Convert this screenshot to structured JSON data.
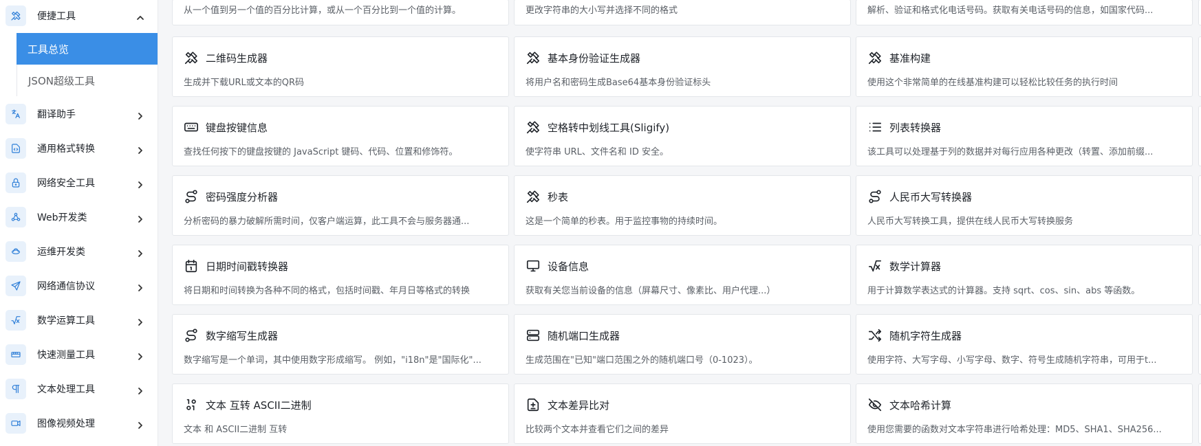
{
  "sidebar": {
    "groups": [
      {
        "label": "便捷工具",
        "icon": "tools-icon",
        "expanded": true
      },
      {
        "label": "翻译助手",
        "icon": "translate-icon"
      },
      {
        "label": "通用格式转换",
        "icon": "file-convert-icon"
      },
      {
        "label": "网络安全工具",
        "icon": "lock-icon"
      },
      {
        "label": "Web开发类",
        "icon": "webhook-icon"
      },
      {
        "label": "运维开发类",
        "icon": "devops-icon"
      },
      {
        "label": "网络通信协议",
        "icon": "send-icon"
      },
      {
        "label": "数学运算工具",
        "icon": "sqrt-icon"
      },
      {
        "label": "快速测量工具",
        "icon": "ruler-icon"
      },
      {
        "label": "文本处理工具",
        "icon": "pilcrow-icon"
      },
      {
        "label": "图像视频处理",
        "icon": "video-icon"
      }
    ],
    "sub_items": [
      {
        "label": "工具总览",
        "active": true
      },
      {
        "label": "JSON超级工具",
        "active": false
      }
    ]
  },
  "top_cards": [
    {
      "desc": "从一个值到另一个值的百分比计算，或从一个百分比到一个值的计算。"
    },
    {
      "desc": "更改字符串的大小写并选择不同的格式"
    },
    {
      "desc": "解析、验证和格式化电话号码。获取有关电话号码的信息，如国家代码..."
    }
  ],
  "cards": [
    {
      "title": "二维码生成器",
      "desc": "生成并下载URL或文本的QR码",
      "icon": "tools-icon"
    },
    {
      "title": "基本身份验证生成器",
      "desc": "将用户名和密码生成Base64基本身份验证标头",
      "icon": "tools-icon"
    },
    {
      "title": "基准构建",
      "desc": "使用这个非常简单的在线基准构建可以轻松比较任务的执行时间",
      "icon": "tools-icon"
    },
    {
      "title": "键盘按键信息",
      "desc": "查找任何按下的键盘按键的 JavaScript 键码、代码、位置和修饰符。",
      "icon": "keyboard-icon"
    },
    {
      "title": "空格转中划线工具(Sligify)",
      "desc": "使字符串 URL、文件名和 ID 安全。",
      "icon": "tools-icon"
    },
    {
      "title": "列表转换器",
      "desc": "该工具可以处理基于列的数据并对每行应用各种更改（转置、添加前缀...",
      "icon": "list-icon"
    },
    {
      "title": "密码强度分析器",
      "desc": "分析密码的暴力破解所需时间，仅客户端运算，此工具不会与服务器通...",
      "icon": "route-icon"
    },
    {
      "title": "秒表",
      "desc": "这是一个简单的秒表。用于监控事物的持续时间。",
      "icon": "tools-icon"
    },
    {
      "title": "人民币大写转换器",
      "desc": "人民币大写转换工具，提供在线人民币大写转换服务",
      "icon": "route-icon"
    },
    {
      "title": "日期时间戳转换器",
      "desc": "将日期和时间转换为各种不同的格式，包括时间戳、年月日等格式的转换",
      "icon": "calendar-icon"
    },
    {
      "title": "设备信息",
      "desc": "获取有关您当前设备的信息（屏幕尺寸、像素比、用户代理...）",
      "icon": "monitor-icon"
    },
    {
      "title": "数学计算器",
      "desc": "用于计算数学表达式的计算器。支持 sqrt、cos、sin、abs 等函数。",
      "icon": "sqrt-icon"
    },
    {
      "title": "数字缩写生成器",
      "desc": "数字缩写是一个单词，其中使用数字形成缩写。 例如，\"i18n\"是\"国际化\"...",
      "icon": "route-icon"
    },
    {
      "title": "随机端口生成器",
      "desc": "生成范围在\"已知\"端口范围之外的随机端口号（0-1023）。",
      "icon": "server-icon"
    },
    {
      "title": "随机字符生成器",
      "desc": "使用字符、大写字母、小写字母、数字、符号生成随机字符串，可用于t...",
      "icon": "shuffle-icon"
    },
    {
      "title": "文本 互转 ASCII二进制",
      "desc": "文本 和 ASCII二进制 互转",
      "icon": "binary-icon"
    },
    {
      "title": "文本差异比对",
      "desc": "比较两个文本并查看它们之间的差异",
      "icon": "file-diff-icon"
    },
    {
      "title": "文本哈希计算",
      "desc": "使用您需要的函数对文本字符串进行哈希处理：MD5、SHA1、SHA256...",
      "icon": "eye-off-icon"
    }
  ]
}
